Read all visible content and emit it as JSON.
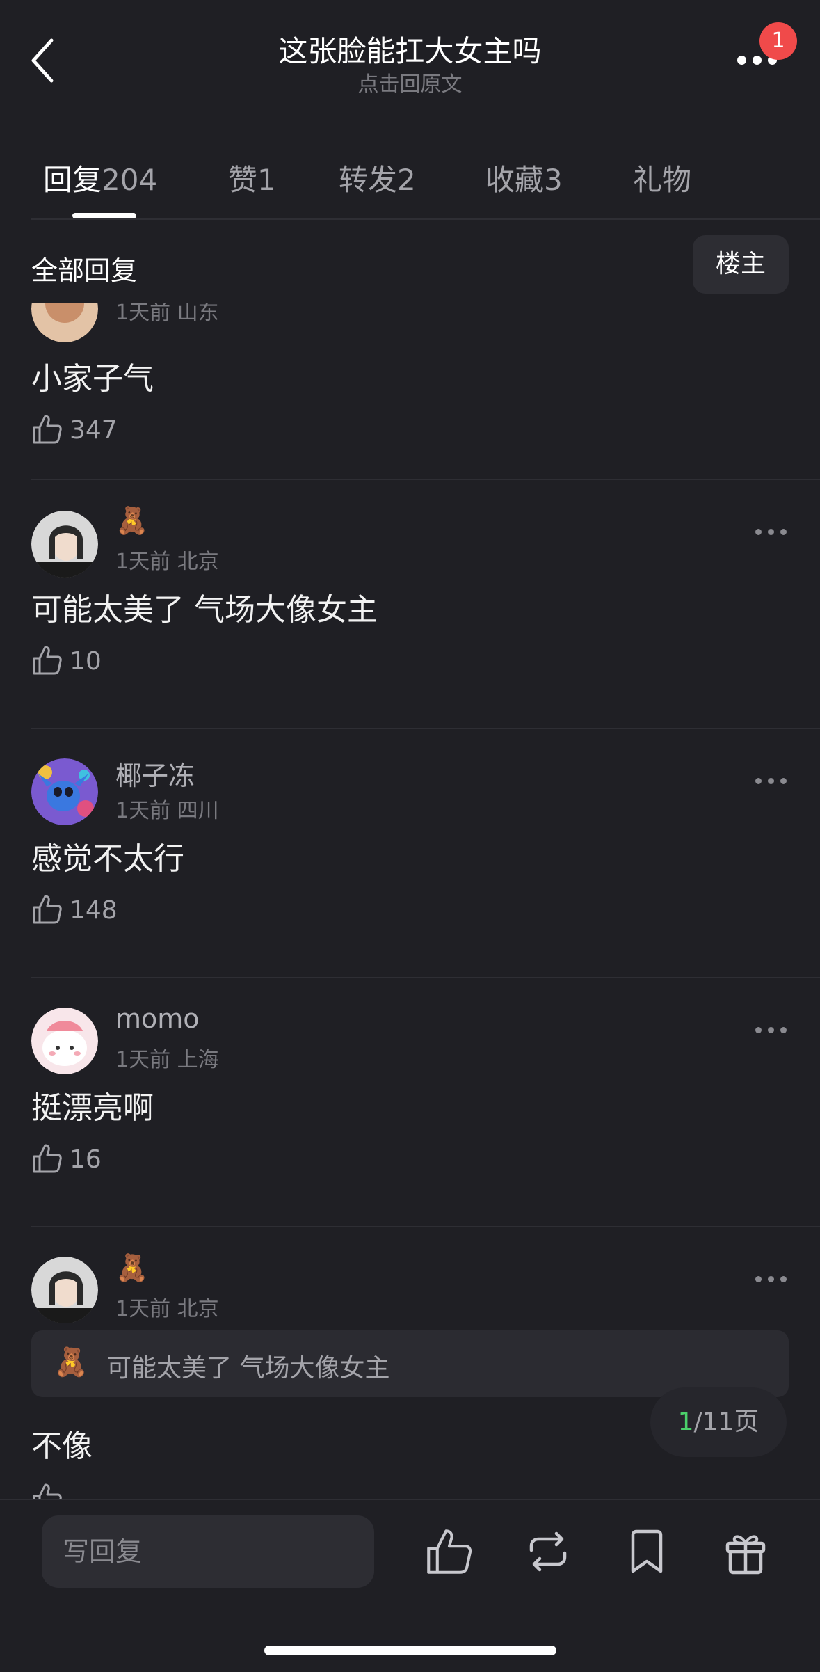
{
  "header": {
    "title": "这张脸能扛大女主吗",
    "subtitle": "点击回原文",
    "notification_count": "1"
  },
  "tabs": [
    {
      "label": "回复",
      "count": "204",
      "active": true
    },
    {
      "label": "赞",
      "count": "1"
    },
    {
      "label": "转发",
      "count": "2"
    },
    {
      "label": "收藏",
      "count": "3"
    },
    {
      "label": "礼物",
      "count": ""
    }
  ],
  "filter": {
    "label": "全部回复",
    "op_button": "楼主"
  },
  "comments": [
    {
      "username": "",
      "meta": "1天前 山东",
      "content": "小家子气",
      "likes": "347",
      "avatar": "avatar-partial"
    },
    {
      "username": "🧸",
      "meta": "1天前 北京",
      "content": "可能太美了 气场大像女主",
      "likes": "10",
      "avatar": "avatar-girl-photo"
    },
    {
      "username": "椰子冻",
      "meta": "1天前 四川",
      "content": "感觉不太行",
      "likes": "148",
      "avatar": "avatar-stitch"
    },
    {
      "username": "momo",
      "meta": "1天前 上海",
      "content": "挺漂亮啊",
      "likes": "16",
      "avatar": "avatar-pink-cartoon"
    },
    {
      "username": "🧸",
      "meta": "1天前 北京",
      "quote_user": "🧸",
      "quote": "可能太美了 气场大像女主",
      "content": "不像",
      "likes": "",
      "avatar": "avatar-girl-photo"
    }
  ],
  "pager": {
    "current": "1",
    "total": "/11页"
  },
  "bottom_bar": {
    "reply_placeholder": "写回复",
    "icons": [
      "like-icon",
      "repost-icon",
      "bookmark-icon",
      "gift-icon"
    ]
  },
  "colors": {
    "background": "#1f1f24",
    "badge": "#f04a4a",
    "pager_current": "#4bd06a"
  }
}
